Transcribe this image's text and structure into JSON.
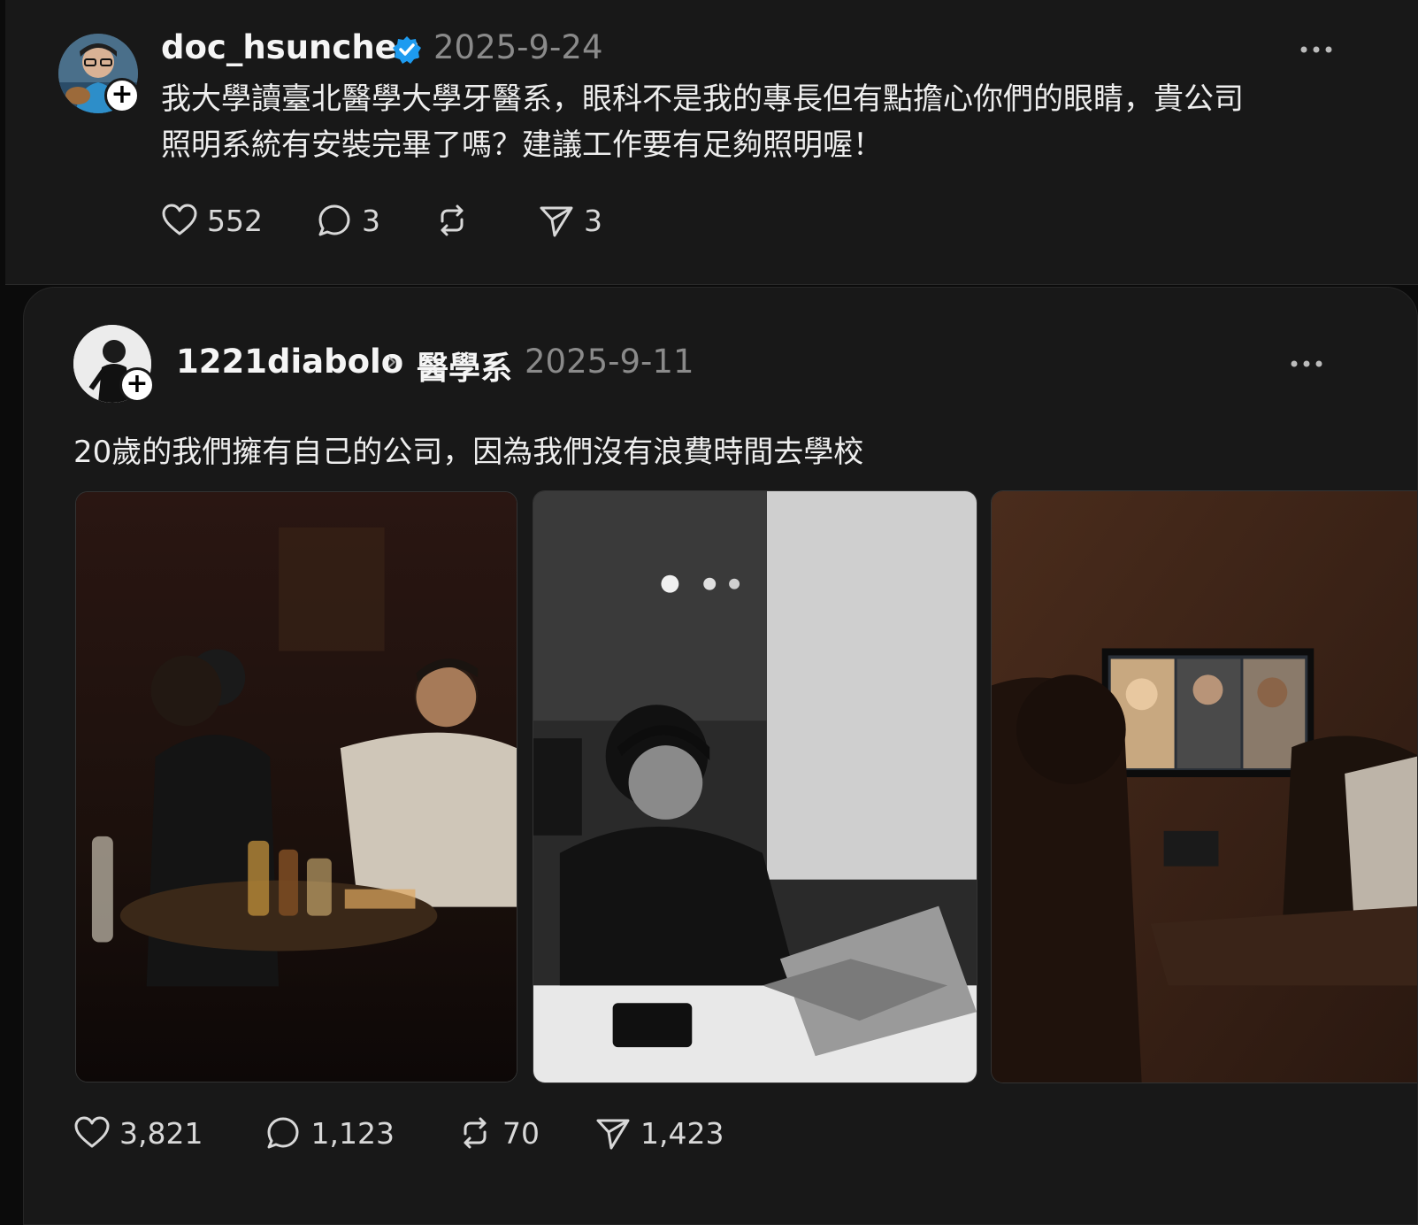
{
  "post1": {
    "username": "doc_hsunchen",
    "date": "2025-9-24",
    "text_line1": "我大學讀臺北醫學大學牙醫系，眼科不是我的專長但有點擔心你們的眼睛，貴公司",
    "text_line2": "照明系統有安裝完畢了嗎？建議工作要有足夠照明喔！",
    "likes": "552",
    "comments": "3",
    "reposts": "",
    "shares": "3"
  },
  "post2": {
    "username": "1221diabolo",
    "topic": "醫學系",
    "date": "2025-9-11",
    "text": "20歲的我們擁有自己的公司，因為我們沒有浪費時間去學校",
    "likes": "3,821",
    "comments": "1,123",
    "reposts": "70",
    "shares": "1,423"
  },
  "icons": {
    "like": "heart-icon",
    "comment": "speech-bubble-icon",
    "repost": "repost-arrows-icon",
    "share": "paper-plane-icon",
    "verified": "verified-badge-icon",
    "more": "more-dots-icon",
    "follow": "plus-icon"
  },
  "colors": {
    "background": "#181818",
    "verified": "#1d9bf0",
    "muted": "#8a8a8a"
  }
}
